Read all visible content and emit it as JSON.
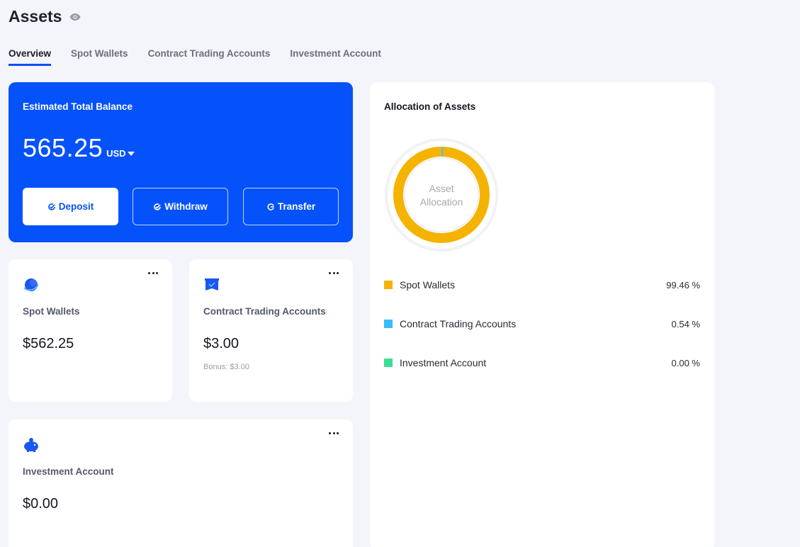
{
  "header": {
    "title": "Assets",
    "visibility_icon": "eye-icon"
  },
  "tabs": [
    {
      "label": "Overview",
      "active": true
    },
    {
      "label": "Spot Wallets",
      "active": false
    },
    {
      "label": "Contract Trading Accounts",
      "active": false
    },
    {
      "label": "Investment Account",
      "active": false
    }
  ],
  "balance": {
    "label": "Estimated Total Balance",
    "value": "565.25",
    "currency": "USD",
    "buttons": {
      "deposit": "Deposit",
      "withdraw": "Withdraw",
      "transfer": "Transfer"
    }
  },
  "accounts": {
    "spot": {
      "label": "Spot Wallets",
      "amount": "$562.25",
      "icon": "planet-icon"
    },
    "contract": {
      "label": "Contract Trading Accounts",
      "amount": "$3.00",
      "bonus": "Bonus: $3.00",
      "icon": "chart-folder-icon"
    },
    "investment": {
      "label": "Investment Account",
      "amount": "$0.00",
      "icon": "piggy-bank-icon"
    }
  },
  "allocation": {
    "title": "Allocation of Assets",
    "center_label_line1": "Asset",
    "center_label_line2": "Allocation",
    "items": [
      {
        "name": "Spot Wallets",
        "percent": "99.46 %",
        "value": 99.46,
        "color": "#f5b301"
      },
      {
        "name": "Contract Trading Accounts",
        "percent": "0.54 %",
        "value": 0.54,
        "color": "#38bdf8"
      },
      {
        "name": "Investment Account",
        "percent": "0.00 %",
        "value": 0.0,
        "color": "#3ddc97"
      }
    ]
  },
  "colors": {
    "accent": "#0552fb",
    "background": "#f4f5fa"
  }
}
